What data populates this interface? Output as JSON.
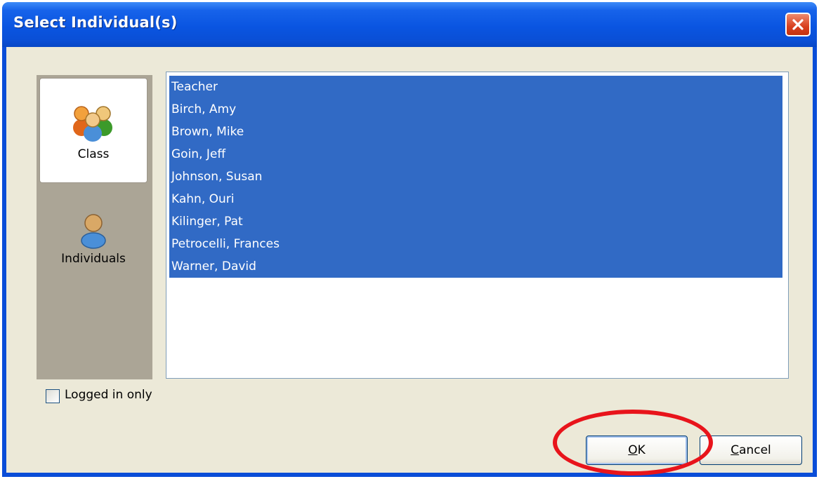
{
  "dialog": {
    "title": "Select Individual(s)",
    "close_label": "Close"
  },
  "sidebar": {
    "items": [
      {
        "label": "Class",
        "icon": "group-icon",
        "selected": true
      },
      {
        "label": "Individuals",
        "icon": "person-icon",
        "selected": false
      }
    ]
  },
  "list": {
    "items": [
      "Teacher",
      "Birch, Amy",
      "Brown, Mike",
      "Goin, Jeff",
      "Johnson, Susan",
      "Kahn, Ouri",
      "Kilinger, Pat",
      "Petrocelli, Frances",
      "Warner, David"
    ],
    "all_selected": true
  },
  "options": {
    "logged_in_only_label": "Logged in only",
    "logged_in_only_checked": false
  },
  "buttons": {
    "ok": {
      "mnemonic": "O",
      "rest": "K"
    },
    "cancel": {
      "mnemonic": "C",
      "rest": "ancel"
    }
  },
  "colors": {
    "titlebar": "#0a55e1",
    "selection": "#316ac5",
    "client_bg": "#ece9d8",
    "sidebar_bg": "#aba596",
    "annotation": "#e8141b"
  }
}
